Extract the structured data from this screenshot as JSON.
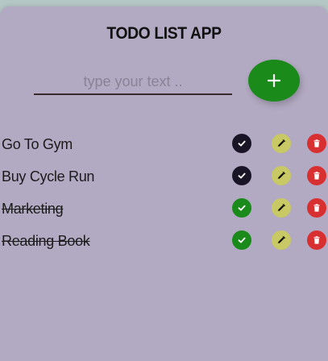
{
  "app": {
    "title": "TODO LIST APP"
  },
  "input": {
    "placeholder": "type your text ..",
    "value": ""
  },
  "add_button": {
    "icon": "plus-icon",
    "color": "#1a8a1a"
  },
  "todos": [
    {
      "text": "Go To Gym",
      "completed": false
    },
    {
      "text": "Buy Cycle Run",
      "completed": false
    },
    {
      "text": "Marketing",
      "completed": true
    },
    {
      "text": "Reading Book",
      "completed": true
    }
  ],
  "action_icons": {
    "complete": "check-circle-icon",
    "edit": "pencil-icon",
    "delete": "trash-icon"
  },
  "colors": {
    "background": "#b5c7c5",
    "card": "#b2a9c2",
    "check_pending": "#1a1526",
    "check_done": "#1a8a1a",
    "edit": "#c8c864",
    "delete": "#d83030"
  }
}
